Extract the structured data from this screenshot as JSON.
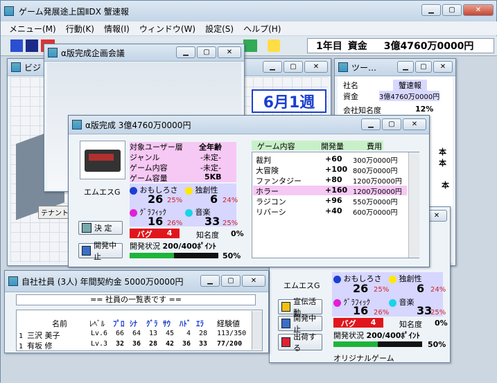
{
  "main_window": {
    "title": "ゲーム発展途上国ⅡDX 蟹速報",
    "menu": [
      "メニュー(M)",
      "行動(K)",
      "情報(I)",
      "ウィンドウ(W)",
      "設定(S)",
      "ヘルプ(H)"
    ],
    "status_year": "1年目",
    "status_funds_label": "資金",
    "status_funds": "3億4760万0000円"
  },
  "meeting_window": {
    "title": "α版完成企画会議"
  },
  "office_window": {
    "title_partial": "ビジ",
    "calendar": "6月1週",
    "tenant_label": "テナント募集"
  },
  "info_window": {
    "title_partial": "ツー…",
    "rows": [
      {
        "label": "社名",
        "value": "蟹速報"
      },
      {
        "label": "資金",
        "value": "3億4760万0000円"
      },
      {
        "label": "会社知名度",
        "value": "12%"
      }
    ],
    "side_fragments": [
      "本",
      "本",
      "本"
    ]
  },
  "alpha_window": {
    "title": "α版完成 3億4760万0000円",
    "console_name": "エムエスG",
    "specs": [
      {
        "label": "対象ユーザー層",
        "value": "全年齢"
      },
      {
        "label": "ジャンル",
        "value": "-未定-"
      },
      {
        "label": "ゲーム内容",
        "value": "-未定-"
      },
      {
        "label": "ゲーム容量",
        "value": "5KB"
      }
    ],
    "stats": {
      "fun_label": "おもしろさ",
      "fun": "26",
      "fun_pct": "25%",
      "orig_label": "独創性",
      "orig": "6",
      "orig_pct": "24%",
      "gfx_label": "ｸﾞﾗﾌｨｯｸ",
      "gfx": "16",
      "gfx_pct": "26%",
      "snd_label": "音楽",
      "snd": "33",
      "snd_pct": "25%"
    },
    "bug_label": "バグ",
    "bug_value": "4",
    "fame_label": "知名度",
    "fame_value": "0%",
    "progress_label": "開発状況",
    "progress_text": "200/400ﾎﾟｲﾝﾄ",
    "progress_pct": "50%",
    "progress": 0.5,
    "decide_btn": "決 定",
    "cancel_btn": "開発中止",
    "list_headers": [
      "ゲーム内容",
      "開発量",
      "費用"
    ],
    "content_rows": [
      {
        "name": "裁判",
        "amount": "+60",
        "cost": "300万0000円",
        "selected": false
      },
      {
        "name": "大冒険",
        "amount": "+100",
        "cost": "800万0000円",
        "selected": false
      },
      {
        "name": "ファンタジー",
        "amount": "+80",
        "cost": "1200万0000円",
        "selected": false
      },
      {
        "name": "ホラー",
        "amount": "+160",
        "cost": "1200万0000円",
        "selected": true
      },
      {
        "name": "ラジコン",
        "amount": "+96",
        "cost": "550万0000円",
        "selected": false
      },
      {
        "name": "リバーシ",
        "amount": "+40",
        "cost": "600万0000円",
        "selected": false
      }
    ]
  },
  "staff_window": {
    "title": "自社社員 (3人) 年間契約金 5000万0000円",
    "banner": "== 社員の一覧表です ==",
    "headers": [
      "名前",
      "ﾚﾍﾞﾙ",
      "ﾌﾟﾛ",
      "ｼﾅ",
      "ｸﾞﾗ",
      "ｻｳ",
      "ﾊﾄﾞ",
      "ｴﾗ",
      "経験値"
    ],
    "rows": [
      {
        "idx": "1",
        "name": "三沢 美子",
        "level": "Lv.6",
        "p": "66",
        "s": "64",
        "g": "13",
        "sd": "45",
        "h": "4",
        "e": "28",
        "exp": "113/350"
      },
      {
        "idx": "1",
        "name": "有坂 修",
        "level": "Lv.3",
        "p": "32",
        "s": "36",
        "g": "28",
        "sd": "42",
        "h": "36",
        "e": "33",
        "exp": "77/200"
      }
    ]
  },
  "dev_window": {
    "console_name": "エムエスG",
    "stats": {
      "fun_label": "おもしろさ",
      "fun": "26",
      "fun_pct": "25%",
      "orig_label": "独創性",
      "orig": "6",
      "orig_pct": "24%",
      "gfx_label": "ｸﾞﾗﾌｨｯｸ",
      "gfx": "16",
      "gfx_pct": "26%",
      "snd_label": "音楽",
      "snd": "33",
      "snd_pct": "25%"
    },
    "promo_btn": "宣伝活動",
    "cancel_btn": "開発中止",
    "ship_btn": "出荷する",
    "bug_label": "バグ",
    "bug_value": "4",
    "fame_label": "知名度",
    "fame_value": "0%",
    "progress_label": "開発状況",
    "progress_text": "200/400ﾎﾟｲﾝﾄ",
    "progress_pct": "50%",
    "progress": 0.5,
    "genre_label": "オリジナルゲーム"
  },
  "colors": {
    "accent_blue": "#1a3fd0",
    "bug_red": "#e0161c",
    "progress_green": "#1eb43c",
    "highlight_pink": "#f6c8f4"
  }
}
